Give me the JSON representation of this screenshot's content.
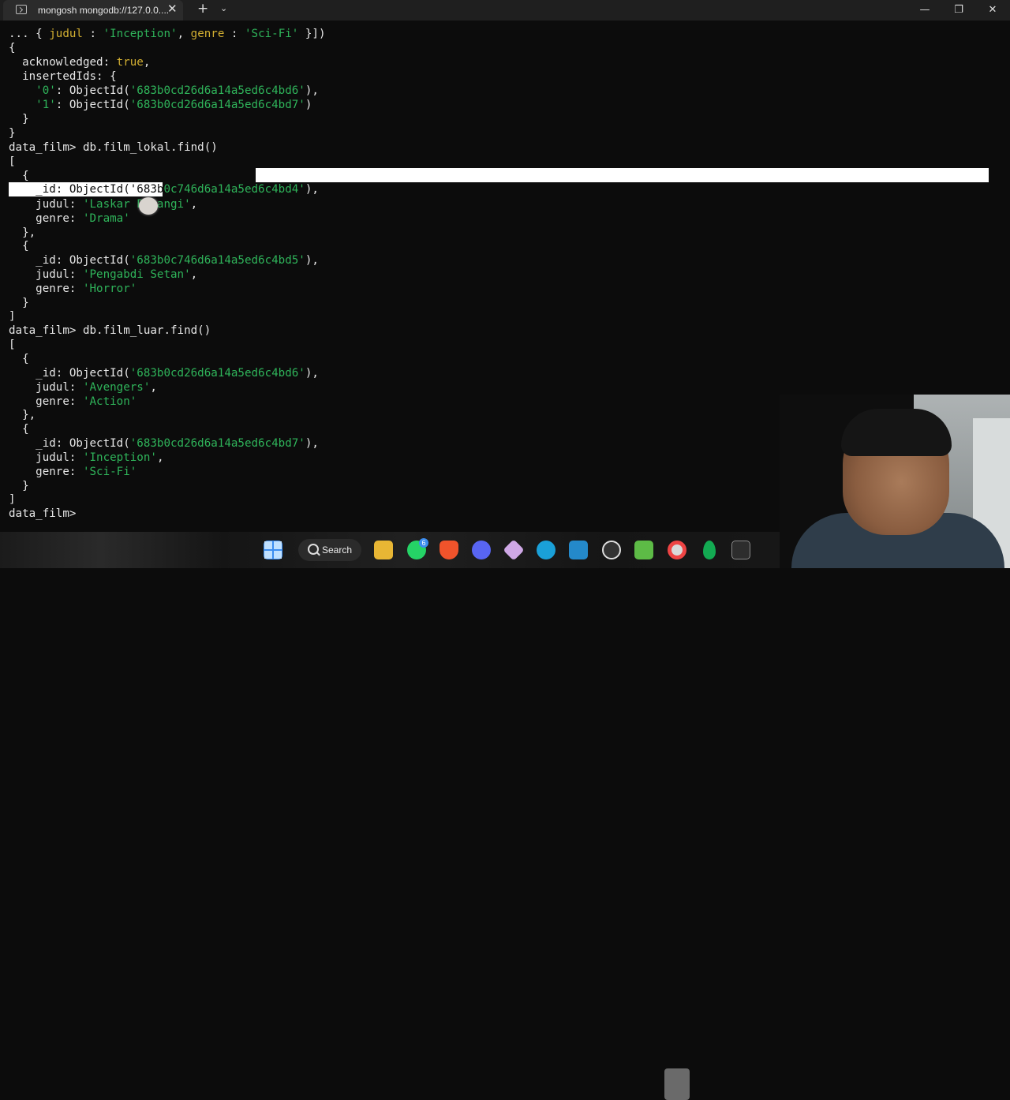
{
  "window": {
    "tab_title": "mongosh mongodb://127.0.0....",
    "tab_close": "✕",
    "new_tab": "+",
    "dropdown": "⌄",
    "minimize": "—",
    "maximize": "❐",
    "close": "✕"
  },
  "terminal": {
    "l1": {
      "a": "... { ",
      "b": "judul",
      "c": " : ",
      "d": "'Inception'",
      "e": ", ",
      "f": "genre",
      "g": " : ",
      "h": "'Sci-Fi'",
      "i": " }])"
    },
    "l2": "{",
    "l3": {
      "a": "  acknowledged: ",
      "b": "true",
      "c": ","
    },
    "l4": "  insertedIds: {",
    "l5": {
      "a": "    ",
      "b": "'0'",
      "c": ": ObjectId(",
      "d": "'683b0cd26d6a14a5ed6c4bd6'",
      "e": "),"
    },
    "l6": {
      "a": "    ",
      "b": "'1'",
      "c": ": ObjectId(",
      "d": "'683b0cd26d6a14a5ed6c4bd7'",
      "e": ")"
    },
    "l7": "  }",
    "l8": "}",
    "l9": "data_film> db.film_lokal.find()",
    "l10": "[",
    "l11": "  {",
    "l12": {
      "sel": "    _id: ObjectId('683b",
      "rest": "0c746d6a14a5ed6c4bd4'",
      "end": "),"
    },
    "l13": {
      "a": "    judul: ",
      "b": "'Laskar Pelangi'",
      "c": ","
    },
    "l14": {
      "a": "    genre: ",
      "b": "'Drama'"
    },
    "l15": "  },",
    "l16": "  {",
    "l17": {
      "a": "    _id: ObjectId(",
      "b": "'683b0c746d6a14a5ed6c4bd5'",
      "c": "),"
    },
    "l18": {
      "a": "    judul: ",
      "b": "'Pengabdi Setan'",
      "c": ","
    },
    "l19": {
      "a": "    genre: ",
      "b": "'Horror'"
    },
    "l20": "  }",
    "l21": "]",
    "l22": "data_film> db.film_luar.find()",
    "l23": "[",
    "l24": "  {",
    "l25": {
      "a": "    _id: ObjectId(",
      "b": "'683b0cd26d6a14a5ed6c4bd6'",
      "c": "),"
    },
    "l26": {
      "a": "    judul: ",
      "b": "'Avengers'",
      "c": ","
    },
    "l27": {
      "a": "    genre: ",
      "b": "'Action'"
    },
    "l28": "  },",
    "l29": "  {",
    "l30": {
      "a": "    _id: ObjectId(",
      "b": "'683b0cd26d6a14a5ed6c4bd7'",
      "c": "),"
    },
    "l31": {
      "a": "    judul: ",
      "b": "'Inception'",
      "c": ","
    },
    "l32": {
      "a": "    genre: ",
      "b": "'Sci-Fi'"
    },
    "l33": "  }",
    "l34": "]",
    "l35": "data_film> "
  },
  "taskbar": {
    "search_label": "Search",
    "whatsapp_badge": "6",
    "icons": [
      "windows-start-icon",
      "search-icon",
      "file-explorer-icon",
      "whatsapp-icon",
      "brave-browser-icon",
      "discord-icon",
      "cube-app-icon",
      "edge-browser-icon",
      "vscode-icon",
      "obs-icon",
      "android-studio-icon",
      "recorder-icon",
      "mongodb-compass-icon",
      "terminal-icon"
    ]
  },
  "colors": {
    "string": "#2fb45a",
    "keyword_bool": "#d4b032",
    "text": "#e8e8e8",
    "background": "#0c0c0c"
  }
}
